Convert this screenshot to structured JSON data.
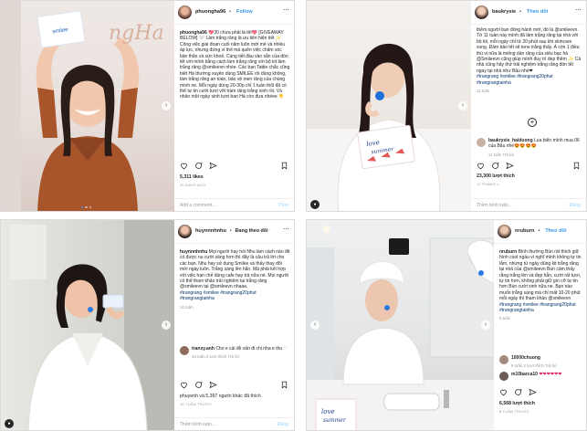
{
  "colors": {
    "link": "#3897f0",
    "hashtag": "#003569",
    "muted": "#999999",
    "border": "#dbdbdb"
  },
  "icons": [
    "heart-icon",
    "comment-icon",
    "share-icon",
    "bookmark-icon",
    "more-icon",
    "chevron-right-icon",
    "chevron-left-icon",
    "add-circle-icon"
  ],
  "post1": {
    "username": "phuongha96",
    "separator": "•",
    "follow": "Follow",
    "box_text": "smilee",
    "photo_text": "ngHa",
    "caption": "💖30 chưa phải là tết💖 [GIVEAWAY BELOW] 🤍 Làm trắng răng là ưu tiên hiện tiết ✨ Công việc giai đoạn cuối năm luôn mới mẻ và nhiều áp lực, nhưng đừng vì thế mà quên việc chăm sóc bản thân và sức khoẻ. Cùng tiết đầu vào sẵn của đón tết với mình bằng cách làm trắng răng với bộ kit làm trắng răng @smileevn nhée. Các bạn Tattie chắc cũng biết Hà thường xuyên dùng SMILEE rồi dùng không, làm trắng răng an toàn, bảo vệ men răng của chúng mình ne. Mỗi ngày dùng 20-30p chỉ 1 tuần thôi đã có thể tự tin cười tươi với hàm răng trắng xinh rồi. Và nhân một ngày sinh tươi ban Hà còn đưa nhéee 👇",
    "likes": "5,311 likes",
    "time": "20 DAYS AGO",
    "add_comment": "Add a comment...",
    "post_button": "Post"
  },
  "post2": {
    "username": "baukrysie",
    "separator": "•",
    "follow": "Theo dõi",
    "box_text": "love summer",
    "caption": "thêm người bạn đồng hành mới, đó là @smileevn. Tớ 11 tuần này mình đã làm trắng răng tại nhà với bộ kit, mỗi ngày chỉ từ 20 phút sau khi skincare xong. Đảm bảo tết sẽ tone trắng thấy. À còn 1 điều thú vị nữa là miếng dán răng của siêu bạc hà @Smileevn cũng giúp mình đuy trì đẹp thêm ✨ Cả nhà cũng hãy thử trải nghiệm trắng răng đón tết ngay tại nhà như Bâu nhé❤",
    "hashtags": "#trangrang #smilee #trangrang20phut #trangrangtainha",
    "time": "11 tuần",
    "comment_user": "baukrysie_haiduong",
    "comment_text": "Lụa biên mình mua 06 của Bâu nhé😍😍😍😍",
    "comment_time": "11 tuần   Trả lời",
    "likes": "23,300 lượt thích",
    "date": "11 THÁNG 1",
    "add_comment": "Thêm bình luận...",
    "post_button": "Đăng"
  },
  "post3": {
    "username": "huynnnhnhu",
    "separator": "•",
    "follow": "Đang theo dõi",
    "caption": "Mọi người hay hỏi Nhu làm cách nào để có được nụ cười sáng hơn thì đây là câu trả lời cho các bạn. Nhu hay sử dụng Smilee và thấy thay đổi mới ngày luôn. Trắng sáng lên hẳn. Mà phải kết hợp với việc hạn chế dùng cafe hay trà nữa nè. Mọi người có thể tham khảo trải nghiệm tại trắng răng @smileevn tại @smileevn nhaaa.",
    "hashtags": "#trangrang #smilee #trangrang20phut #trangrangtainha",
    "time": "10 tuần",
    "comment_user": "tranxy.anh",
    "comment_text": "Cho e cái đề vấn đi chị nha e thu",
    "comment_time": "10 tuần   2 lượt thích   Trả lời",
    "likes": "phuyenh và 5,397 người khác đã thích",
    "date": "10 TUẦN TRƯỚC",
    "add_comment": "Thêm bình luận...",
    "post_button": "Đăng"
  },
  "post4": {
    "username": "nruburn",
    "separator": "•",
    "follow": "Theo dõi",
    "box_text": "love summer",
    "caption": "Bình thường Bún rất thích giữ hình cool ngầu vì nghĩ mình không tự tin lắm, nhưng từ ngày dùng kit trắng răng tại nhà của @smileevn Bún cảm thấy rằng trắng lên và đẹp hẳn, cười rất tươi, tự tin hơn, không phải giữ gìn cỡ tự tin hơn Bún cười xinh nữa ne. Bạn nào muốn trắng sáng mà chỉ mất 10-20 phút mỗi ngày thì tham khảo @smileevn",
    "hashtags": "#trangrang #smilee #trangrang20phut #trangrangtainha",
    "time": "8 tuần",
    "comment1_user": "10000chuong",
    "comment1_text": "",
    "comment1_time": "8 tuần   2 lượt thích   Trả lời",
    "comment2_user": "m10barca10",
    "comment2_text": "❤❤❤❤❤❤",
    "likes": "6,568 lượt thích",
    "date": "8 TUẦN TRƯỚC"
  }
}
